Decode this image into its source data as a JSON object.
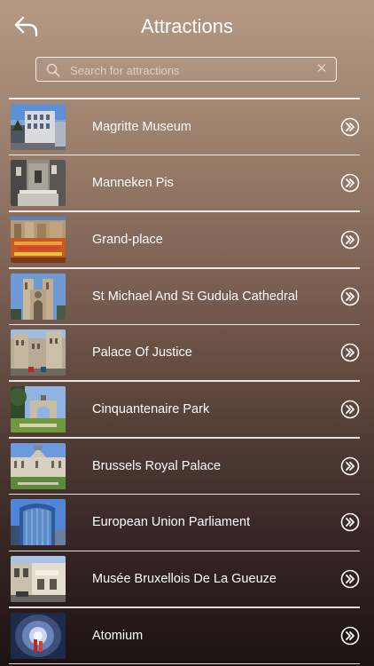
{
  "header": {
    "title": "Attractions",
    "back_icon": "back-arrow-icon"
  },
  "search": {
    "placeholder": "Search for attractions",
    "value": "",
    "clear_glyph": "✕"
  },
  "attractions": [
    {
      "name": "Magritte Museum",
      "thumb": "magritte-museum-photo"
    },
    {
      "name": "Manneken Pis",
      "thumb": "manneken-pis-photo"
    },
    {
      "name": "Grand-place",
      "thumb": "grand-place-photo"
    },
    {
      "name": "St Michael And St Gudula Cathedral",
      "thumb": "cathedral-photo"
    },
    {
      "name": "Palace Of Justice",
      "thumb": "palace-of-justice-photo"
    },
    {
      "name": "Cinquantenaire Park",
      "thumb": "cinquantenaire-park-photo"
    },
    {
      "name": "Brussels Royal Palace",
      "thumb": "royal-palace-photo"
    },
    {
      "name": "European Union Parliament",
      "thumb": "eu-parliament-photo"
    },
    {
      "name": "Musée Bruxellois De La Gueuze",
      "thumb": "gueuze-museum-photo"
    },
    {
      "name": "Atomium",
      "thumb": "atomium-photo"
    }
  ],
  "colors": {
    "background_top": "#b49a85",
    "background_bottom": "#1c1212",
    "text": "#ffffff"
  }
}
